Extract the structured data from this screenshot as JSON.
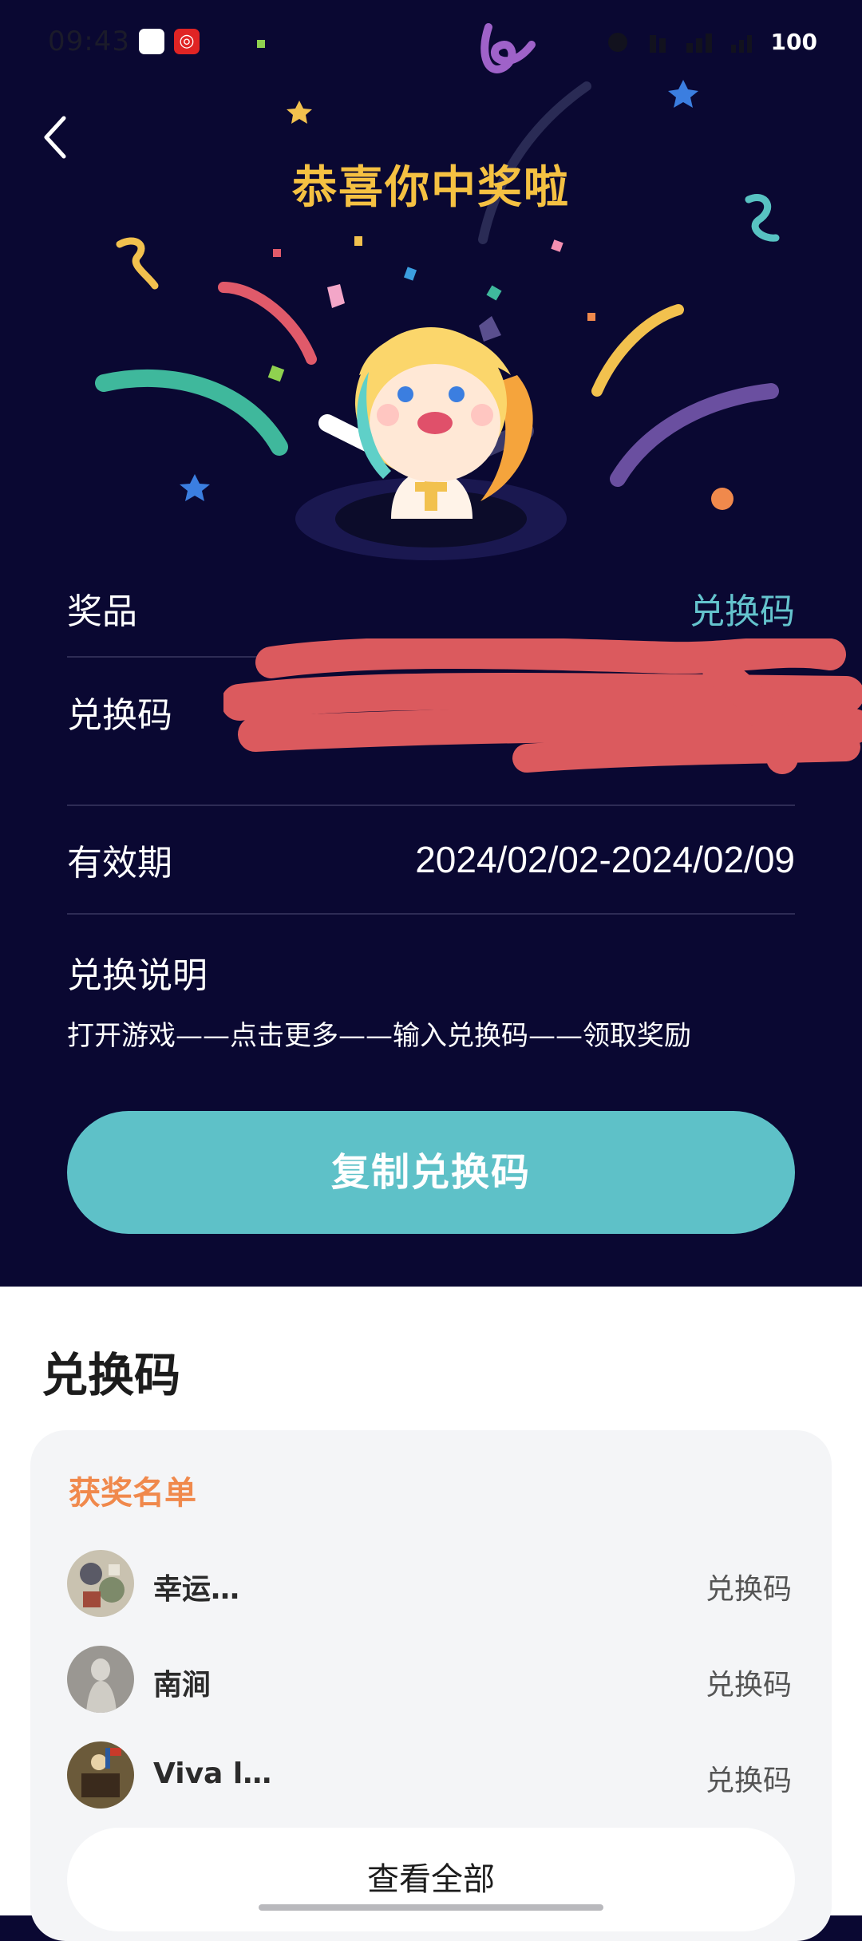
{
  "status_bar": {
    "time": "09:43",
    "battery": "100",
    "app2_icon": "netease-music-icon"
  },
  "header": {
    "back_icon": "chevron-left-icon",
    "title": "恭喜你中奖啦"
  },
  "prize": {
    "label": "奖品",
    "value": "兑换码"
  },
  "code": {
    "label": "兑换码"
  },
  "validity": {
    "label": "有效期",
    "value": "2024/02/02-2024/02/09"
  },
  "instructions": {
    "title": "兑换说明",
    "text": "打开游戏——点击更多——输入兑换码——领取奖励"
  },
  "copy_button": {
    "label": "复制兑换码"
  },
  "section": {
    "title": "兑换码"
  },
  "winners": {
    "title": "获奖名单",
    "items": [
      {
        "name": "幸运…",
        "prize": "兑换码"
      },
      {
        "name": "南涧",
        "prize": "兑换码"
      },
      {
        "name": "Viva l…",
        "prize": "兑换码"
      }
    ],
    "view_all": "查看全部"
  },
  "colors": {
    "background": "#0a0832",
    "title": "#f5c142",
    "accent": "#5ec1c8",
    "winners_title": "#f0894c"
  }
}
